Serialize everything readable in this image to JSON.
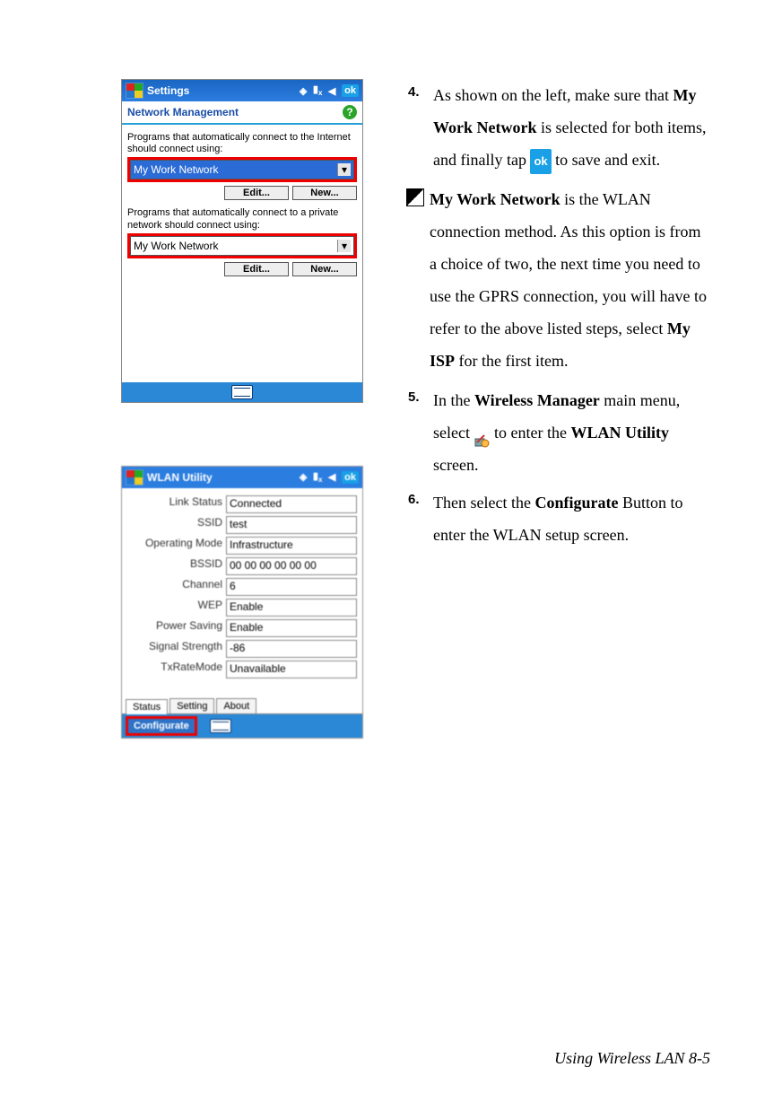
{
  "screenshot1": {
    "titlebar": {
      "title": "Settings",
      "ok": "ok"
    },
    "header": "Network Management",
    "label1": "Programs that automatically connect to the Internet should connect using:",
    "select1": "My Work Network",
    "label2": "Programs that automatically connect to a private network should connect using:",
    "select2": "My Work Network",
    "edit": "Edit...",
    "new": "New..."
  },
  "screenshot2": {
    "titlebar": {
      "title": "WLAN Utility",
      "ok": "ok"
    },
    "rows": {
      "link_status": {
        "label": "Link Status",
        "value": "Connected"
      },
      "ssid": {
        "label": "SSID",
        "value": "test"
      },
      "op_mode": {
        "label": "Operating Mode",
        "value": "Infrastructure"
      },
      "bssid": {
        "label": "BSSID",
        "value": "00 00 00 00 00 00"
      },
      "channel": {
        "label": "Channel",
        "value": "6"
      },
      "wep": {
        "label": "WEP",
        "value": "Enable"
      },
      "power": {
        "label": "Power Saving",
        "value": "Enable"
      },
      "signal": {
        "label": "Signal Strength",
        "value": "-86"
      },
      "txrate": {
        "label": "TxRateMode",
        "value": "Unavailable"
      }
    },
    "tabs": {
      "status": "Status",
      "setting": "Setting",
      "about": "About"
    },
    "configurate": "Configurate"
  },
  "steps": {
    "s4": {
      "num": "4.",
      "t1": "As shown on the left, make sure that ",
      "b1": "My Work Network",
      "t2": " is selected for both items, and finally tap ",
      "ok": "ok",
      "t3": " to save and exit."
    },
    "note": {
      "b1": "My Work Network",
      "t1": " is the WLAN connection method. As this option is from a choice of two, the next time you need to use the GPRS connection, you will have to refer to the above listed steps, select ",
      "b2": "My ISP",
      "t2": " for the first item."
    },
    "s5": {
      "num": "5.",
      "t1": "In the ",
      "b1": "Wireless Manager",
      "t2": " main menu, select ",
      "t3": " to enter the ",
      "b2": "WLAN Utility",
      "t4": " screen."
    },
    "s6": {
      "num": "6.",
      "t1": "Then select the ",
      "b1": "Configurate",
      "t2": " Button to enter the WLAN setup screen."
    }
  },
  "footer": "Using Wireless LAN    8-5"
}
